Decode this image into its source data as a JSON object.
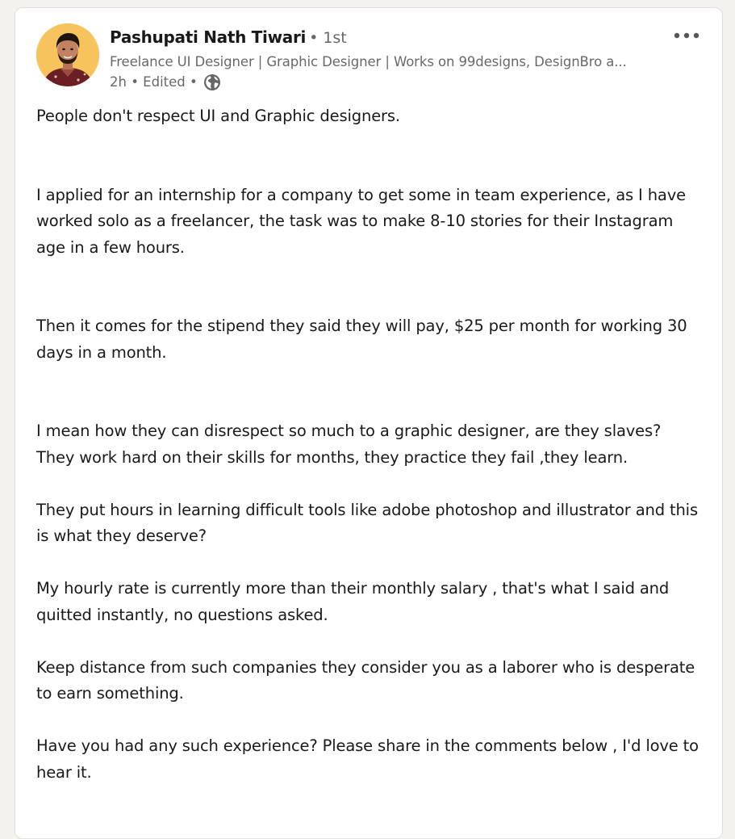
{
  "post": {
    "author": {
      "name": "Pashupati Nath Tiwari",
      "degree": "• 1st",
      "headline": "Freelance UI Designer | Graphic Designer | Works on 99designs, DesignBro a...",
      "time": "2h • Edited •",
      "avatar_icon": "profile-photo",
      "visibility_icon": "globe-icon"
    },
    "menu_icon": "more-options-icon",
    "paragraphs": [
      "People don't respect UI and Graphic designers.",
      "I applied for an internship for a company to get some in team experience, as I have worked solo as a freelancer, the task was to make 8-10 stories for their Instagram age in a few hours.",
      "Then it comes for the stipend they said they will pay, $25 per month for working 30 days in a month.",
      "I mean how they can disrespect so much to a graphic designer, are they slaves?",
      "They work hard on their skills for months, they practice they fail ,they learn.",
      "They put hours in learning difficult tools like adobe photoshop and illustrator and this is what they deserve?",
      "My hourly rate is currently more than their monthly salary , that's what I said and quitted instantly, no questions asked.",
      "Keep distance from such companies they consider you as a laborer who is desperate to earn something.",
      "Have you had any such experience? Please share in the comments below , I'd love to hear it."
    ]
  },
  "colors": {
    "page_background": "#f3f2ef",
    "card_background": "#ffffff",
    "primary_text": "#191919",
    "secondary_text": "#666666",
    "avatar_background": "#f6c35c"
  }
}
